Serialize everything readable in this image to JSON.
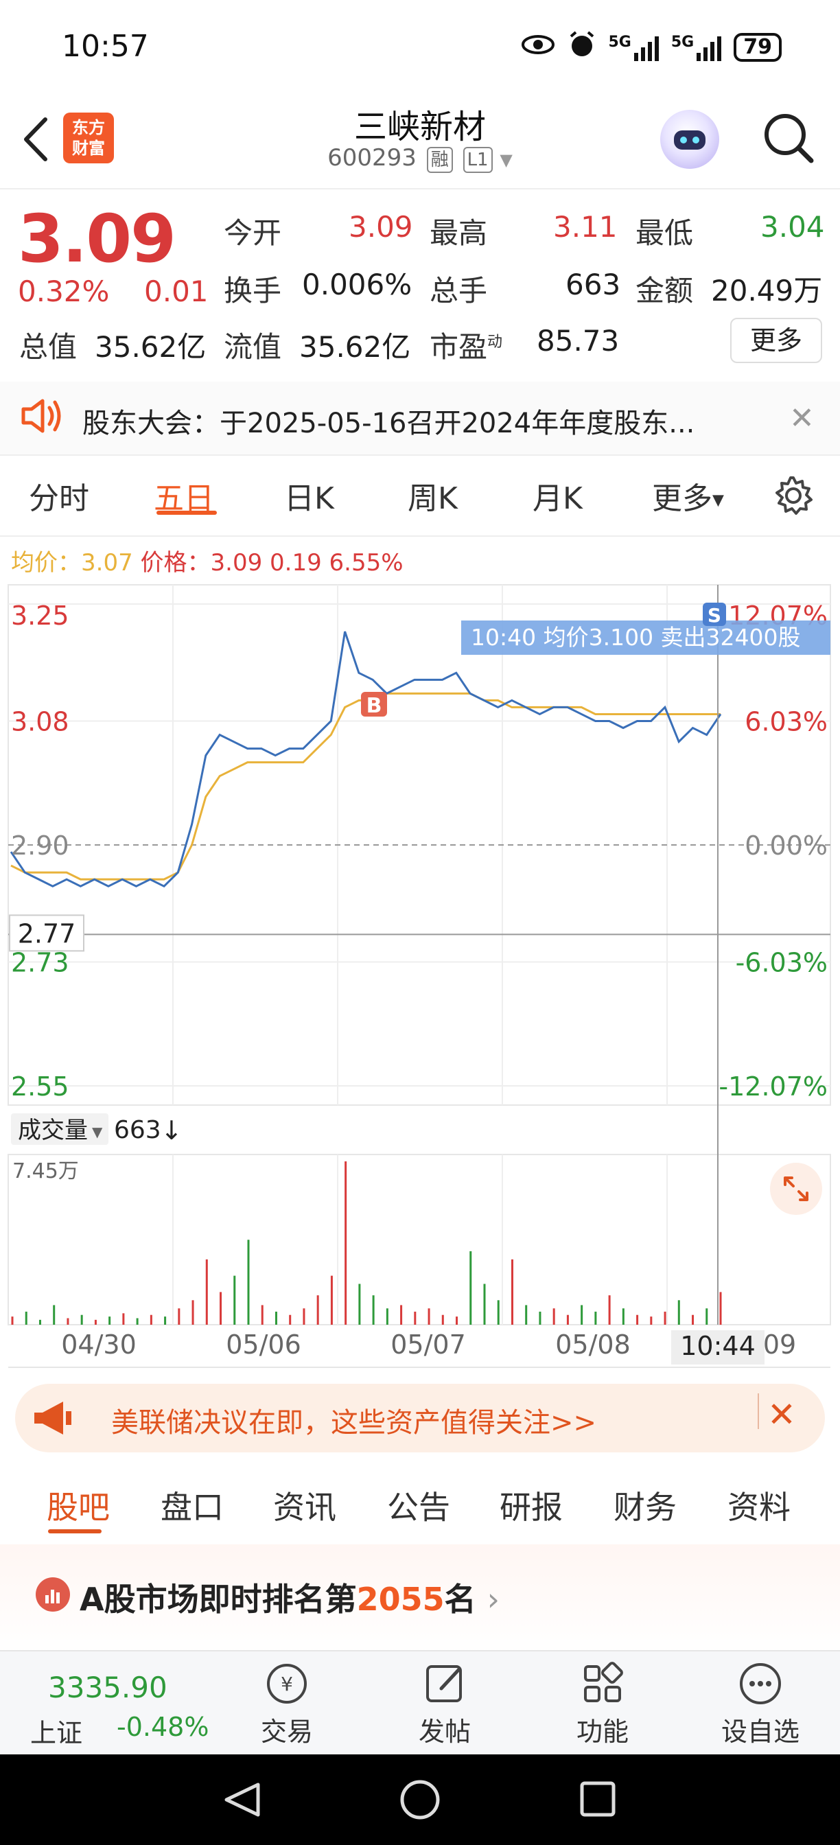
{
  "status_bar": {
    "time": "10:57",
    "battery": "79"
  },
  "header": {
    "logo_line1": "东方",
    "logo_line2": "财富",
    "stock_name": "三峡新材",
    "stock_code": "600293",
    "tag_margin": "融",
    "tag_level": "L1"
  },
  "quote": {
    "price": "3.09",
    "change_pct": "0.32%",
    "change_abs": "0.01",
    "open_label": "今开",
    "open_value": "3.09",
    "high_label": "最高",
    "high_value": "3.11",
    "low_label": "最低",
    "low_value": "3.04",
    "turnover_label": "换手",
    "turnover_value": "0.006%",
    "volume_label": "总手",
    "volume_value": "663",
    "amount_label": "金额",
    "amount_value": "20.49万",
    "mktcap_label": "总值",
    "mktcap_value": "35.62亿",
    "float_label": "流值",
    "float_value": "35.62亿",
    "pe_label": "市盈",
    "pe_sup": "动",
    "pe_value": "85.73",
    "more_label": "更多"
  },
  "notice": {
    "text": "股东大会：于2025-05-16召开2024年年度股东..."
  },
  "chart_tabs": [
    "分时",
    "五日",
    "日K",
    "周K",
    "月K",
    "更多"
  ],
  "legend": {
    "avg_label": "均价：",
    "avg_value": "3.07",
    "price_label": "价格：",
    "price_value": "3.09",
    "delta": "0.19",
    "pct": "6.55%"
  },
  "chart_data": {
    "type": "line",
    "y_labels_left": [
      "3.25",
      "3.08",
      "2.90",
      "2.73",
      "2.55"
    ],
    "y_labels_right": [
      "12.07%",
      "6.03%",
      "0.00%",
      "-6.03%",
      "-12.07%"
    ],
    "ylim": [
      2.55,
      3.25
    ],
    "prev_close": 2.9,
    "crosshair_value": "2.77",
    "x_labels": [
      "04/30",
      "05/06",
      "05/07",
      "05/08",
      "09"
    ],
    "crosshair_time": "10:44",
    "tooltip": "10:40  均价3.100  卖出32400股",
    "buy_marker": "B",
    "sell_marker": "S",
    "price_series": [
      2.89,
      2.86,
      2.85,
      2.84,
      2.85,
      2.84,
      2.85,
      2.84,
      2.85,
      2.84,
      2.85,
      2.84,
      2.86,
      2.93,
      3.03,
      3.06,
      3.05,
      3.04,
      3.04,
      3.03,
      3.04,
      3.04,
      3.06,
      3.08,
      3.21,
      3.15,
      3.14,
      3.12,
      3.13,
      3.14,
      3.14,
      3.14,
      3.15,
      3.12,
      3.11,
      3.1,
      3.11,
      3.1,
      3.09,
      3.1,
      3.1,
      3.09,
      3.08,
      3.08,
      3.07,
      3.08,
      3.08,
      3.1,
      3.05,
      3.07,
      3.06,
      3.09
    ],
    "avg_series": [
      2.87,
      2.86,
      2.86,
      2.86,
      2.86,
      2.85,
      2.85,
      2.85,
      2.85,
      2.85,
      2.85,
      2.85,
      2.86,
      2.9,
      2.97,
      3.0,
      3.01,
      3.02,
      3.02,
      3.02,
      3.02,
      3.02,
      3.04,
      3.06,
      3.1,
      3.11,
      3.11,
      3.12,
      3.12,
      3.12,
      3.12,
      3.12,
      3.12,
      3.12,
      3.11,
      3.11,
      3.1,
      3.1,
      3.1,
      3.1,
      3.1,
      3.1,
      3.09,
      3.09,
      3.09,
      3.09,
      3.09,
      3.09,
      3.09,
      3.09,
      3.09,
      3.09
    ],
    "volume_label": "成交量",
    "volume_value": "663",
    "volume_max": "7.45万",
    "volume_series": [
      0.05,
      0.08,
      0.03,
      0.12,
      0.04,
      0.06,
      0.03,
      0.05,
      0.07,
      0.04,
      0.06,
      0.05,
      0.1,
      0.15,
      0.4,
      0.2,
      0.3,
      0.52,
      0.12,
      0.08,
      0.06,
      0.1,
      0.18,
      0.3,
      1.0,
      0.25,
      0.18,
      0.1,
      0.12,
      0.08,
      0.1,
      0.06,
      0.05,
      0.45,
      0.25,
      0.15,
      0.4,
      0.12,
      0.08,
      0.1,
      0.06,
      0.12,
      0.08,
      0.18,
      0.1,
      0.06,
      0.05,
      0.08,
      0.15,
      0.06,
      0.1,
      0.2
    ]
  },
  "banner": {
    "text": "美联储决议在即，这些资产值得关注>>"
  },
  "bottom_tabs": [
    "股吧",
    "盘口",
    "资讯",
    "公告",
    "研报",
    "财务",
    "资料"
  ],
  "rank": {
    "prefix": "A股市场即时排名第",
    "number": "2055",
    "suffix": "名"
  },
  "bottom_nav": {
    "index_value": "3335.90",
    "index_name": "上证",
    "index_change": "-0.48%",
    "items": [
      "交易",
      "发帖",
      "功能",
      "设自选"
    ]
  }
}
